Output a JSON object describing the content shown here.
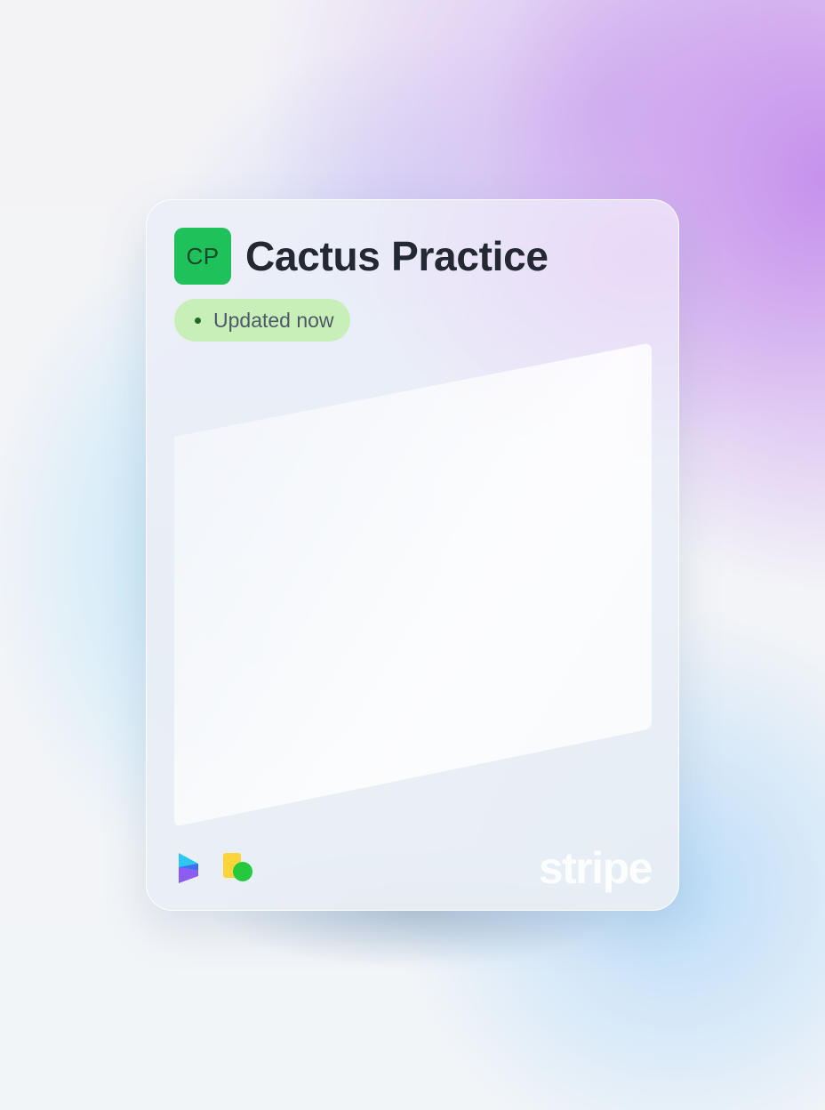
{
  "card": {
    "initials": "CP",
    "title": "Cactus Practice",
    "status": "Updated now"
  },
  "footer": {
    "icons": [
      "streamline-logo-icon",
      "shapes-logo-icon"
    ],
    "brand": "stripe"
  },
  "colors": {
    "avatar_bg": "#1fc15a",
    "status_bg": "#c9efb8",
    "status_dot": "#1d6b25",
    "title": "#232832"
  }
}
